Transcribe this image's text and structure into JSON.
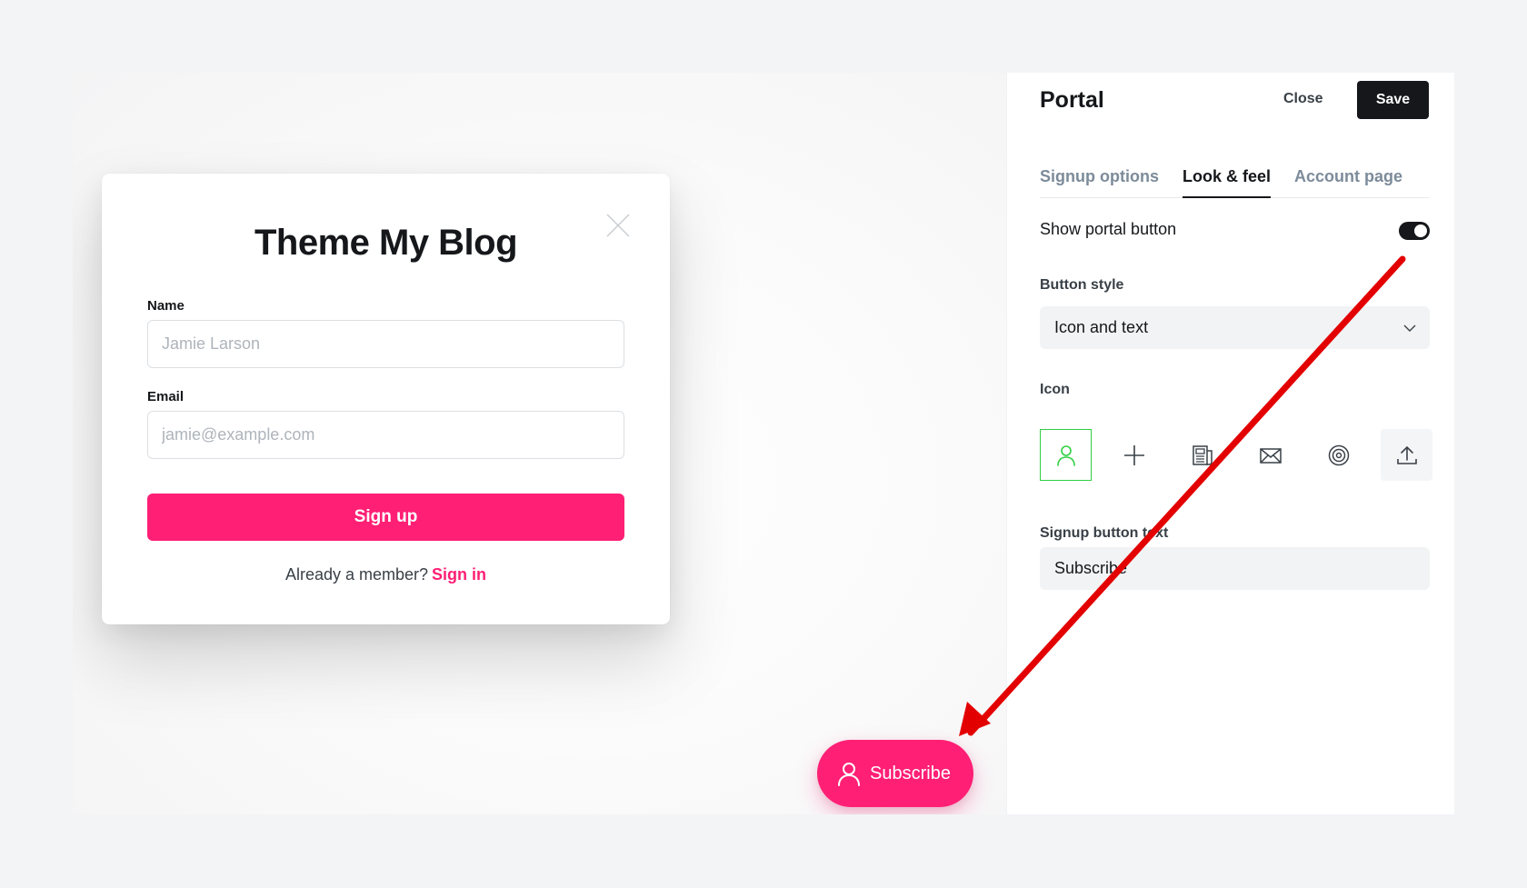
{
  "preview": {
    "modal": {
      "title": "Theme My Blog",
      "name_label": "Name",
      "name_placeholder": "Jamie Larson",
      "email_label": "Email",
      "email_placeholder": "jamie@example.com",
      "signup_label": "Sign up",
      "member_text": "Already a member?",
      "signin_label": "Sign in",
      "close_icon": "close-icon"
    },
    "portal_button": {
      "label": "Subscribe",
      "icon": "user-icon"
    }
  },
  "panel": {
    "title": "Portal",
    "close_label": "Close",
    "save_label": "Save",
    "tabs": [
      {
        "label": "Signup options",
        "active": false
      },
      {
        "label": "Look & feel",
        "active": true
      },
      {
        "label": "Account page",
        "active": false
      }
    ],
    "show_portal_button": {
      "label": "Show portal button",
      "enabled": true
    },
    "button_style": {
      "label": "Button style",
      "value": "Icon and text"
    },
    "icon": {
      "label": "Icon",
      "options": [
        "user-icon",
        "plus-icon",
        "newspaper-icon",
        "envelope-icon",
        "target-icon",
        "upload-icon"
      ],
      "selected": "user-icon"
    },
    "signup_button_text": {
      "label": "Signup button text",
      "value": "Subscribe"
    }
  },
  "colors": {
    "accent": "#ff1f75",
    "selected_icon_border": "#30cf43",
    "annotation_arrow": "#e30000",
    "dark": "#15171a"
  }
}
